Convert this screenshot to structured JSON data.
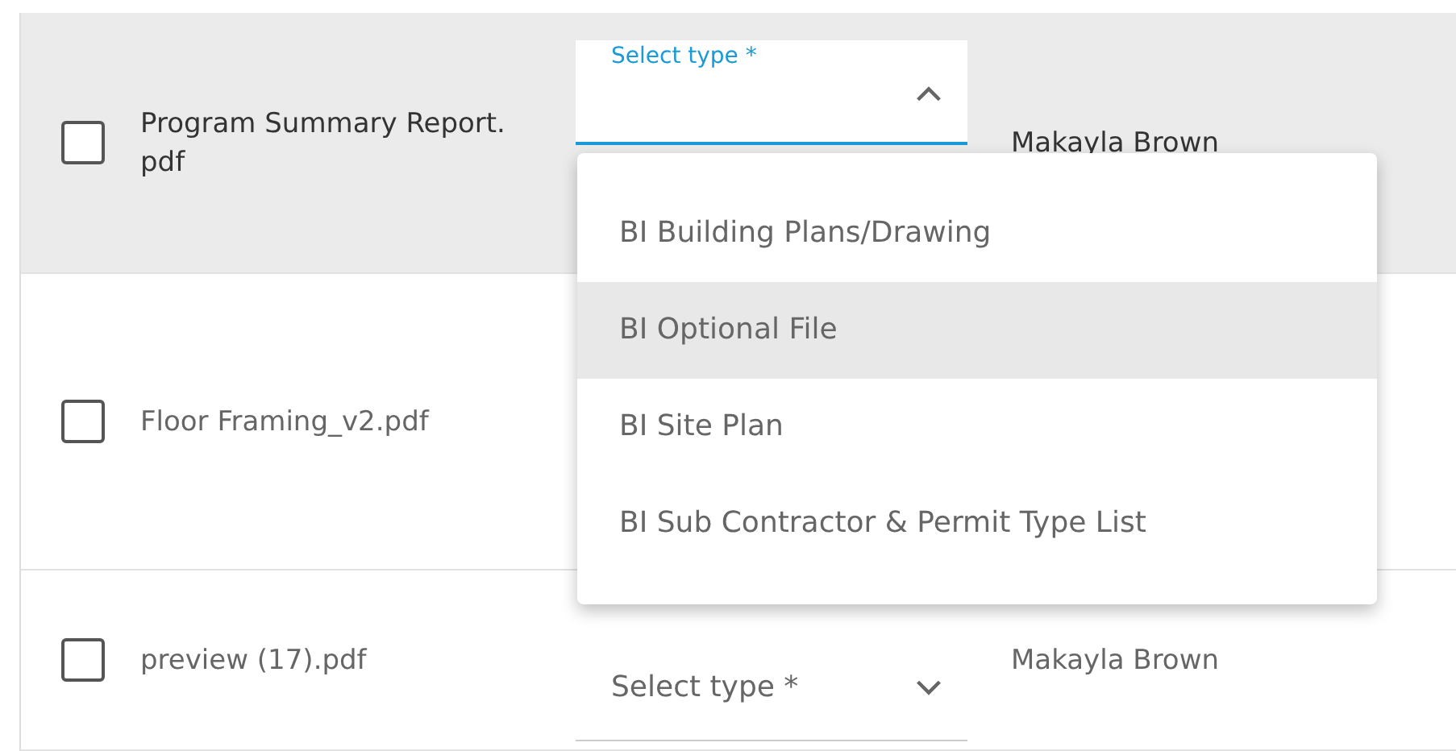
{
  "rows": [
    {
      "selected": true,
      "checked": false,
      "file_name": "Program Summary Report.pdf",
      "type_field": {
        "label": "Select type *",
        "open": true
      },
      "owner": "Makayla Brown"
    },
    {
      "selected": false,
      "checked": false,
      "file_name": "Floor Framing_v2.pdf"
    },
    {
      "selected": false,
      "checked": false,
      "file_name": "preview (17).pdf",
      "type_field": {
        "label": "Select type *",
        "open": false
      },
      "owner": "Makayla Brown"
    }
  ],
  "type_menu": {
    "items": [
      {
        "label": "BI Building Plans/Drawing",
        "selected": false
      },
      {
        "label": "BI Optional File",
        "selected": true
      },
      {
        "label": "BI Site Plan",
        "selected": false
      },
      {
        "label": "BI Sub Contractor & Permit Type List",
        "selected": false
      }
    ]
  }
}
